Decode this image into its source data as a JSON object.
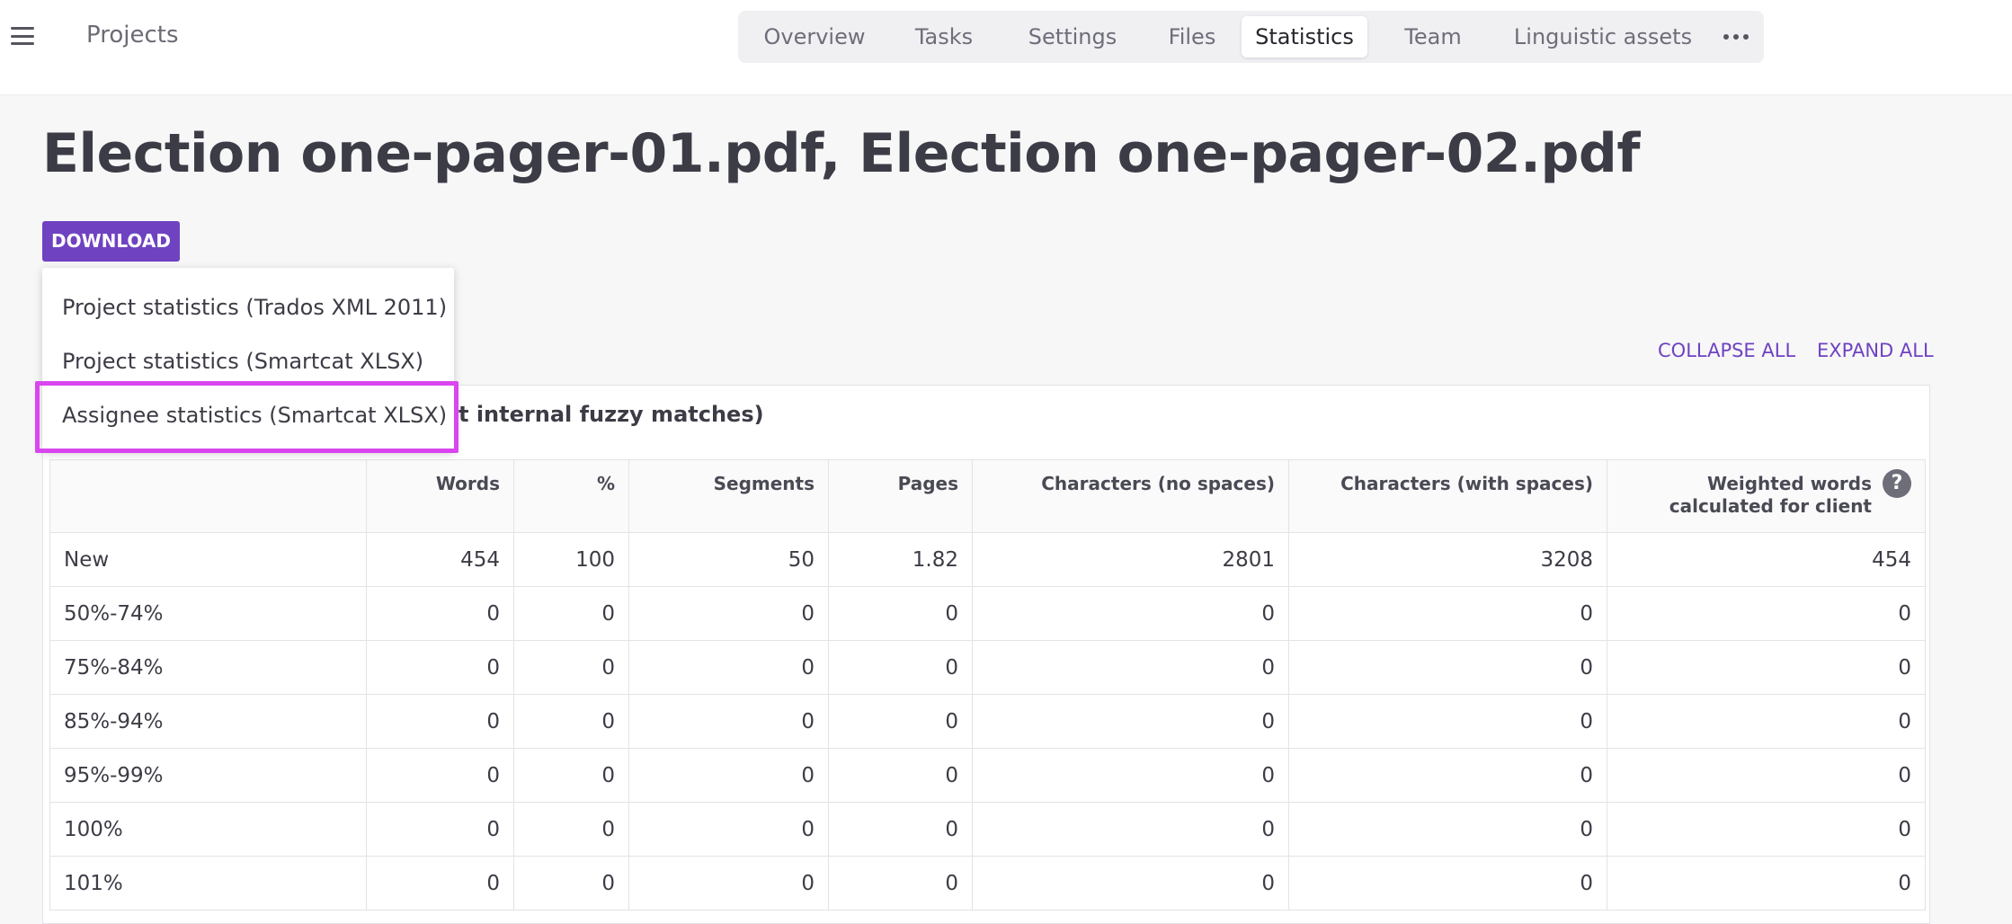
{
  "header": {
    "projects_label": "Projects",
    "tabs": [
      {
        "label": "Overview"
      },
      {
        "label": "Tasks"
      },
      {
        "label": "Settings"
      },
      {
        "label": "Files"
      },
      {
        "label": "Statistics",
        "active": true
      },
      {
        "label": "Team"
      },
      {
        "label": "Linguistic assets"
      }
    ],
    "more_icon": "more-horizontal-icon",
    "menu_icon": "hamburger-menu-icon"
  },
  "page": {
    "title": "Election one-pager-01.pdf, Election one-pager-02.pdf",
    "download_label": "DOWNLOAD",
    "collapse_all": "COLLAPSE ALL",
    "expand_all": "EXPAND ALL"
  },
  "download_menu": {
    "items": [
      {
        "label": "Project statistics (Trados XML 2011)"
      },
      {
        "label": "Project statistics (Smartcat XLSX)"
      },
      {
        "label": "Assignee statistics (Smartcat XLSX)",
        "highlighted": true
      }
    ],
    "highlight_color": "#d946ef"
  },
  "stats_panel": {
    "header_visible": "t internal fuzzy matches)",
    "columns": [
      "",
      "Words",
      "%",
      "Segments",
      "Pages",
      "Characters (no spaces)",
      "Characters (with spaces)",
      "Weighted words calculated for client"
    ],
    "rows": [
      {
        "label": "New",
        "values": [
          "454",
          "100",
          "50",
          "1.82",
          "2801",
          "3208",
          "454"
        ]
      },
      {
        "label": "50%-74%",
        "values": [
          "0",
          "0",
          "0",
          "0",
          "0",
          "0",
          "0"
        ]
      },
      {
        "label": "75%-84%",
        "values": [
          "0",
          "0",
          "0",
          "0",
          "0",
          "0",
          "0"
        ]
      },
      {
        "label": "85%-94%",
        "values": [
          "0",
          "0",
          "0",
          "0",
          "0",
          "0",
          "0"
        ]
      },
      {
        "label": "95%-99%",
        "values": [
          "0",
          "0",
          "0",
          "0",
          "0",
          "0",
          "0"
        ]
      },
      {
        "label": "100%",
        "values": [
          "0",
          "0",
          "0",
          "0",
          "0",
          "0",
          "0"
        ]
      },
      {
        "label": "101%",
        "values": [
          "0",
          "0",
          "0",
          "0",
          "0",
          "0",
          "0"
        ]
      }
    ]
  },
  "colors": {
    "accent": "#6f42c1",
    "highlight": "#d946ef"
  }
}
